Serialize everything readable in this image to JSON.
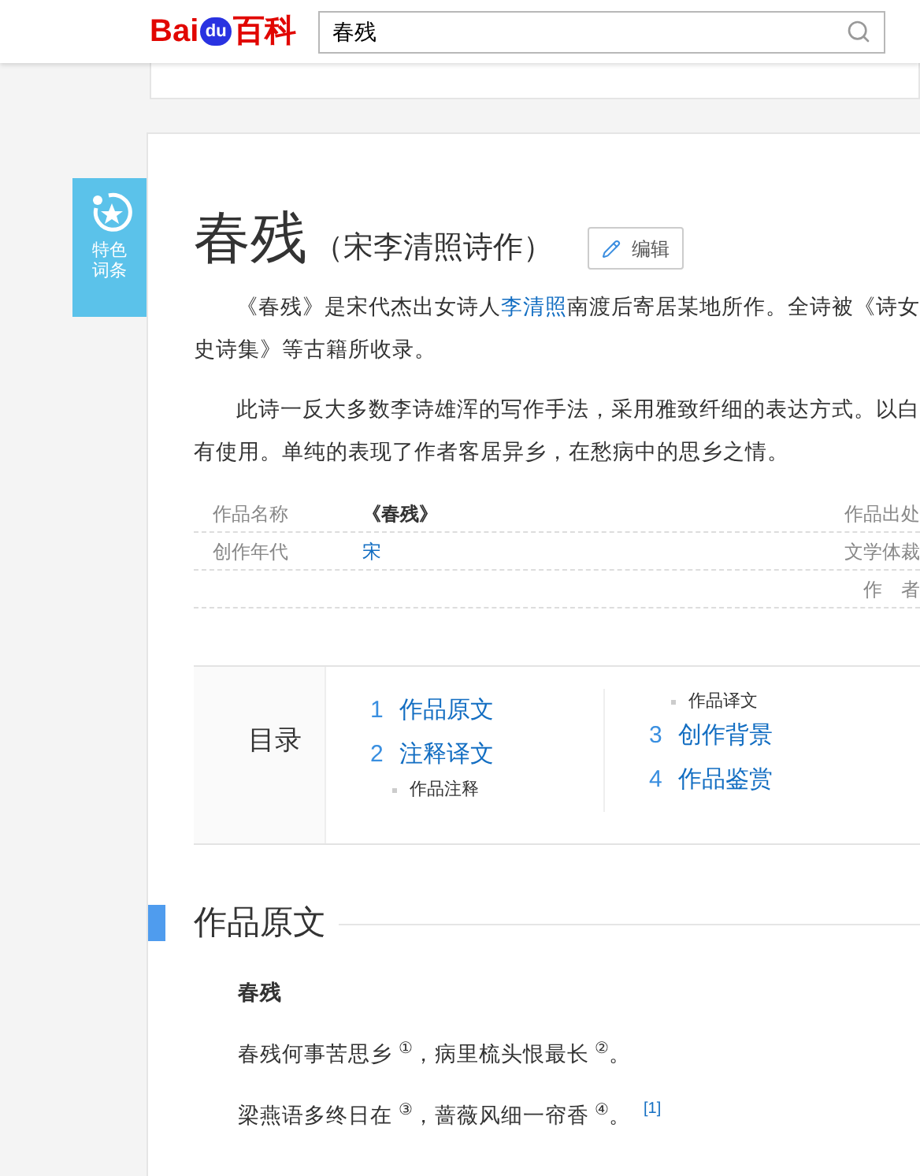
{
  "header": {
    "logo": {
      "part1": "Bai",
      "part2": "du",
      "part3": "百科"
    },
    "search": {
      "value": "春残"
    }
  },
  "badge": {
    "label": "特色词条"
  },
  "title": "春残",
  "subtitle": "（宋李清照诗作）",
  "edit_button": "编辑",
  "paragraphs": [
    {
      "lines": [
        [
          {
            "text": "《春残》是宋代杰出女诗人",
            "link": false
          },
          {
            "text": "李清照",
            "link": true
          },
          {
            "text": "南渡后寄居某地所作。全诗被《诗女",
            "link": false
          }
        ],
        [
          {
            "text": "史诗集》等古籍所收录。",
            "link": false
          }
        ]
      ]
    },
    {
      "lines": [
        [
          {
            "text": "此诗一反大多数李诗雄浑的写作手法，采用雅致纤细的表达方式。以白",
            "link": false
          }
        ],
        [
          {
            "text": "有使用。单纯的表现了作者客居异乡，在愁病中的思乡之情。",
            "link": false
          }
        ]
      ]
    }
  ],
  "infobox": {
    "rows": [
      {
        "label": "作品名称",
        "value": "《春残》",
        "link": false,
        "right_label": "作品出处"
      },
      {
        "label": "创作年代",
        "value": "宋",
        "link": true,
        "right_label": "文学体裁"
      },
      {
        "right_label": "作　者"
      }
    ]
  },
  "toc": {
    "title": "目录",
    "columns": [
      [
        {
          "kind": "section",
          "number": "1",
          "label": "作品原文"
        },
        {
          "kind": "section",
          "number": "2",
          "label": "注释译文"
        },
        {
          "kind": "sub",
          "label": "作品注释"
        }
      ],
      [
        {
          "kind": "sub",
          "label": "作品译文"
        },
        {
          "kind": "section",
          "number": "3",
          "label": "创作背景"
        },
        {
          "kind": "section",
          "number": "4",
          "label": "作品鉴赏"
        }
      ]
    ]
  },
  "section": {
    "heading": "作品原文"
  },
  "poem": {
    "title": "春残",
    "lines": [
      {
        "text": "春残何事苦思乡 $^{①}$，病里梳头恨最长 $^{②}$。"
      },
      {
        "text": "梁燕语多终日在 $^{③}$，蔷薇风细一帘香 $^{④}$。",
        "ref": "[1]"
      }
    ]
  }
}
